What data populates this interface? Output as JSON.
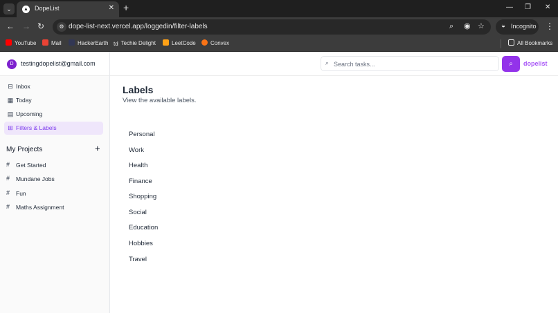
{
  "browser": {
    "tab_title": "DopeList",
    "url": "dope-list-next.vercel.app/loggedin/filter-labels",
    "incognito_label": "Incognito",
    "bookmarks": [
      {
        "label": "YouTube",
        "icon": "youtube-icon",
        "color": "#ff0000"
      },
      {
        "label": "Mail",
        "icon": "gmail-icon",
        "color": "#ea4335"
      },
      {
        "label": "HackerEarth",
        "icon": "hackerearth-icon",
        "color": "#323754"
      },
      {
        "label": "Techie Delight",
        "icon": "techie-delight-icon",
        "color": "#9ca3af"
      },
      {
        "label": "LeetCode",
        "icon": "leetcode-icon",
        "color": "#ffa116"
      },
      {
        "label": "Convex",
        "icon": "convex-icon",
        "color": "#f97316"
      }
    ],
    "all_bookmarks_label": "All Bookmarks"
  },
  "user": {
    "avatar_initial": "D",
    "email": "testingdopelist@gmail.com"
  },
  "nav": [
    {
      "label": "Inbox",
      "icon": "inbox-icon",
      "active": false
    },
    {
      "label": "Today",
      "icon": "calendar-today-icon",
      "active": false
    },
    {
      "label": "Upcoming",
      "icon": "calendar-upcoming-icon",
      "active": false
    },
    {
      "label": "Filters & Labels",
      "icon": "grid-icon",
      "active": true
    }
  ],
  "projects": {
    "title": "My Projects",
    "items": [
      "Get Started",
      "Mundane Jobs",
      "Fun",
      "Maths Assignment"
    ]
  },
  "search": {
    "placeholder": "Search tasks...",
    "value": ""
  },
  "brand": "dopelist",
  "page": {
    "title": "Labels",
    "subtitle": "View the available labels."
  },
  "labels": [
    "Personal",
    "Work",
    "Health",
    "Finance",
    "Shopping",
    "Social",
    "Education",
    "Hobbies",
    "Travel"
  ],
  "colors": {
    "accent": "#9333ea",
    "active_bg": "#efe6fb",
    "active_text": "#7c3aed"
  }
}
